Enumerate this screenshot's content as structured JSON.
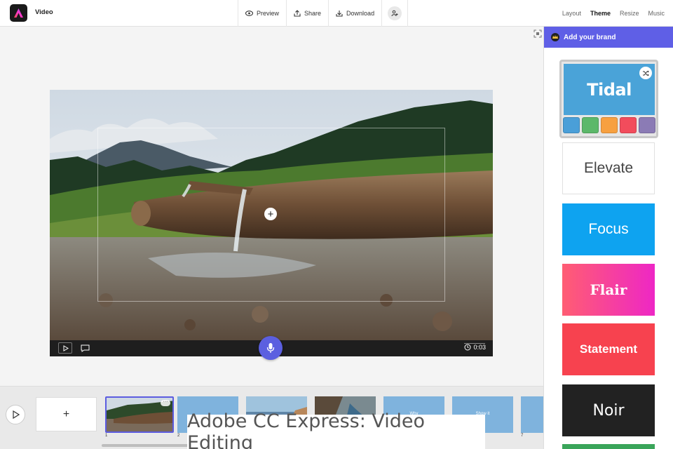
{
  "app": {
    "title": "Video"
  },
  "toolbar": {
    "preview_label": "Preview",
    "share_label": "Share",
    "download_label": "Download"
  },
  "right_tabs": {
    "layout": "Layout",
    "theme": "Theme",
    "resize": "Resize",
    "music": "Music",
    "active": "Theme"
  },
  "player": {
    "time": "0:03"
  },
  "theme_panel": {
    "brand_label": "Add your brand",
    "themes": [
      {
        "name": "Tidal",
        "selected": true,
        "color": "#4aa3d8"
      },
      {
        "name": "Elevate",
        "color": "#ffffff"
      },
      {
        "name": "Focus",
        "color": "#0ea3f0"
      },
      {
        "name": "Flair",
        "color": "#f03fa0"
      },
      {
        "name": "Statement",
        "color": "#f7424f"
      },
      {
        "name": "Noir",
        "color": "#222222"
      }
    ],
    "tidal_swatches": [
      "#4a9fd8",
      "#5cb86a",
      "#f7a040",
      "#f24c5c",
      "#8b7bb5"
    ]
  },
  "timeline": {
    "add_label": "+",
    "clips": [
      {
        "num": "1",
        "type": "video"
      },
      {
        "num": "2",
        "type": "text",
        "label": ""
      },
      {
        "num": "",
        "type": "photo"
      },
      {
        "num": "",
        "type": "photo"
      },
      {
        "num": "",
        "type": "text",
        "label": "Why"
      },
      {
        "num": "",
        "type": "text",
        "label": "Show it"
      },
      {
        "num": "7",
        "type": "text",
        "label": ""
      }
    ]
  },
  "overlay_caption": "Adobe CC Express: Video Editing"
}
